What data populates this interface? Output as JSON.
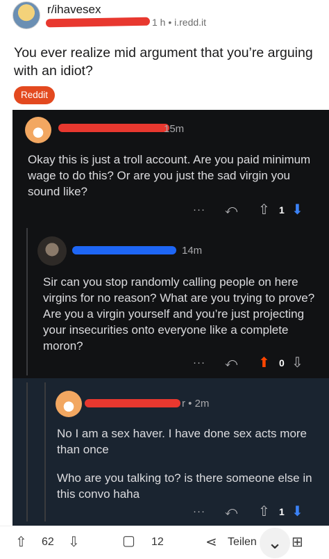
{
  "post": {
    "subreddit": "r/ihavesex",
    "meta": "1 h • i.redd.it",
    "title": "You ever realize mid argument that you’re arguing with an idiot?",
    "flair": "Reddit"
  },
  "comments": [
    {
      "time": "15m",
      "paragraphs": [
        "Okay this is just a troll account. Are you paid minimum wage to do this? Or  are you just the sad virgin you sound like?"
      ],
      "more": "···",
      "reply_icon": "reply-icon",
      "vote_count": "1",
      "vote_state": "downvoted"
    },
    {
      "time": "14m",
      "paragraphs": [
        "Sir can you stop randomly calling people on here virgins for no reason? What are you trying to prove? Are you a virgin yourself and you’re just projecting your insecurities onto everyone like a complete moron?"
      ],
      "more": "···",
      "reply_icon": "reply-icon",
      "vote_count": "0",
      "vote_state": "upvoted"
    },
    {
      "time": "r • 2m",
      "paragraphs": [
        "No I am a sex haver. I have done sex acts more than once",
        "Who are you talking to? is there someone else in this convo haha"
      ],
      "more": "···",
      "reply_icon": "reply-icon",
      "vote_count": "1",
      "vote_state": "downvoted"
    }
  ],
  "bottom_bar": {
    "upvotes": "62",
    "comments": "12",
    "share_label": "Teilen"
  },
  "colors": {
    "redaction_red": "#e8382f",
    "redaction_blue": "#1e66f5",
    "flair": "#e3491f",
    "upvote": "#ff4500",
    "downvote": "#3b82f6",
    "comment_bg": "#111214",
    "highlight_bg": "#1a2430"
  },
  "icons": {
    "upvote": "upvote-icon",
    "downvote": "downvote-icon",
    "comment": "comment-icon",
    "share": "share-icon",
    "collapse": "chevron-down-icon",
    "award": "add-award-icon"
  }
}
